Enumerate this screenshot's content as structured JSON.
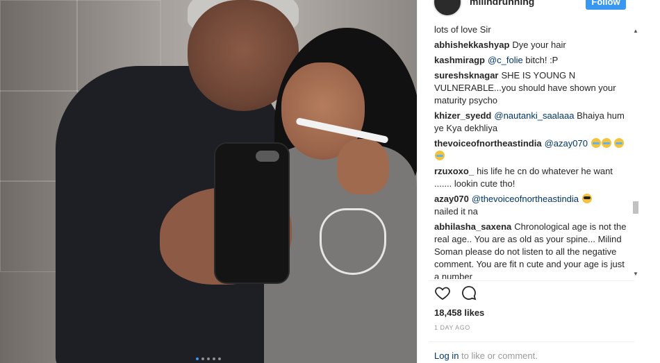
{
  "post": {
    "username": "milindrunning",
    "follow_label": "Follow",
    "likes": "18,458 likes",
    "time": "1 DAY AGO",
    "login_link": "Log in",
    "login_rest": "to like or comment."
  },
  "comments": [
    {
      "user": "",
      "mention": "",
      "text": "lots of love Sir"
    },
    {
      "user": "abhishekkashyap",
      "mention": "",
      "text": "Dye your hair"
    },
    {
      "user": "kashmiragp",
      "mention": "@c_folie",
      "text": "bitch! :P"
    },
    {
      "user": "sureshsknagar",
      "mention": "",
      "text": "SHE IS YOUNG N VULNERABLE...you should have shown your maturity psycho"
    },
    {
      "user": "khizer_syedd",
      "mention": "@nautanki_saalaaa",
      "text": "Bhaiya hum ye Kya dekhliya"
    },
    {
      "user": "thevoiceofnortheastindia",
      "mention": "@azay070",
      "text": ""
    },
    {
      "user": "rzuxoxo_",
      "mention": "",
      "text": "his life he cn do whatever he want ....... lookin cute tho!"
    },
    {
      "user": "azay070",
      "mention": "@thevoiceofnortheastindia",
      "text": ""
    },
    {
      "user": "",
      "mention": "",
      "text": "nailed it na"
    },
    {
      "user": "abhilasha_saxena",
      "mention": "",
      "text": "Chronological age is not the real age.. You are as old as your spine... Milind Soman please do not listen to all the negative comment. You are fit n cute and your age is just a number"
    }
  ],
  "icons": {
    "like": "heart-icon",
    "comment": "comment-icon",
    "scroll_up": "triangle-up",
    "scroll_down": "triangle-down"
  },
  "colors": {
    "accent": "#3897f0",
    "mention": "#003569",
    "muted": "#999999"
  }
}
